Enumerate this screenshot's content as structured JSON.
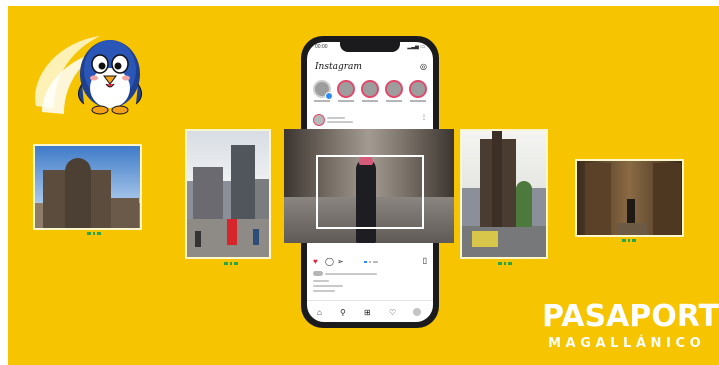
{
  "phone": {
    "status_time": "00:00",
    "app_title": "Instagram",
    "stories_count": 5
  },
  "brand": {
    "line1": "PASAPORTE",
    "line2": "MAGALLÁNICO"
  },
  "icons": {
    "heart": "heart-icon",
    "comment": "comment-icon",
    "share": "share-icon",
    "bookmark": "bookmark-icon",
    "home": "home-icon",
    "search": "search-icon",
    "add": "add-icon",
    "activity": "activity-icon",
    "profile": "profile-icon"
  },
  "colors": {
    "background": "#f6c400",
    "frame": "#fff6c9",
    "like": "#e0243c",
    "brand_text": "#ffffff"
  }
}
